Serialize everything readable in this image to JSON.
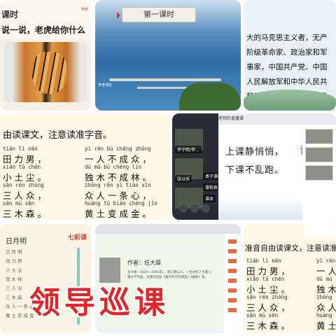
{
  "tiles": {
    "tiger": {
      "line1": "课时",
      "line2": "说一说，老虎给你什么",
      "logo": "学校"
    },
    "lake": {
      "banner": "第一课时",
      "caption": "李老师好"
    },
    "bio": {
      "text": "大的马克思主义者，无产阶级革命家、政治家和军事家，中国共产党、中国人民解放军和中华人民共和国的主要缔造者和领导人之一。"
    },
    "reading": {
      "title": "由读课文，注意读准字音。",
      "rows": [
        [
          {
            "py": "tián lì nán",
            "hz": "田力男，"
          },
          {
            "py": "yì rén bù chéng zhòng",
            "hz": "一人不成众，"
          }
        ],
        [
          {
            "py": "xiǎo tǔ chén",
            "hz": "小土尘。"
          },
          {
            "py": "dú mù bù chéng lín",
            "hz": "独木不成林。"
          }
        ],
        [
          {
            "py": "sān rén zhòng",
            "hz": "三人众，"
          },
          {
            "py": "zhòng rén yì tiáo xīn",
            "hz": "众人一条心，"
          }
        ],
        [
          {
            "py": "sān mù sēn",
            "hz": "三木森。"
          },
          {
            "py": "huáng tǔ biàn chéng jīn",
            "hz": "黄土变成金。"
          }
        ]
      ]
    },
    "live": {
      "title": "老师的直播课",
      "slogan1": "上课静悄悄，",
      "slogan2": "下课不乱跑。",
      "blue_text": "课",
      "tags": [
        "李子熙/李...",
        "张以乐",
        "桌子课前",
        "课程表",
        "课本"
      ]
    },
    "lesson": {
      "title": "日月明",
      "brand": "七彩课",
      "lines": [
        "日月明",
        "田力男",
        "小土尘",
        "双木林",
        "三人众",
        "三木森",
        "众人一条心",
        "黄土变成金"
      ]
    },
    "doc": {
      "author": "作者：任大霖",
      "para": "任大霖（1929—1995年），浙江萧山人，一生创作了大量儿童文学作品，主要作品有《童年时代的朋友》《蟋蟀》等。"
    },
    "reading2": {
      "title": "准音自由读课文，注意读准",
      "rows": [
        [
          {
            "py": "tián lì nán",
            "hz": "田力男，"
          },
          {
            "py": "yì rén",
            "hz": "一人"
          }
        ],
        [
          {
            "py": "xiǎo tǔ chén",
            "hz": "小土尘。"
          },
          {
            "py": "dú mù",
            "hz": "独木"
          }
        ],
        [
          {
            "py": "sān rén zhòng",
            "hz": "三人众，"
          },
          {
            "py": "zhòng",
            "hz": "众人"
          }
        ],
        [
          {
            "py": "sān mù sēn",
            "hz": "三木森。"
          },
          {
            "py": "huáng",
            "hz": "黄土"
          }
        ]
      ]
    }
  },
  "overlay": {
    "text": "领导巡课",
    "color": "#e1262b"
  },
  "icons": [
    "speaker-icon",
    "mic-icon",
    "camera-icon",
    "chat-icon",
    "share-icon"
  ]
}
